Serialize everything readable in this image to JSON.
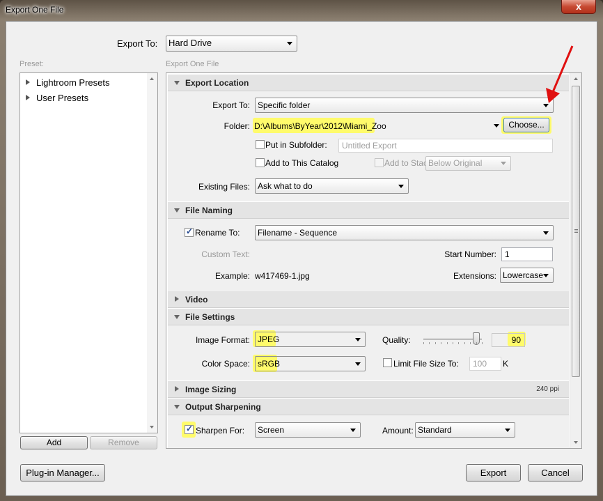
{
  "window": {
    "title": "Export One File",
    "close_glyph": "x"
  },
  "export_to": {
    "label": "Export To:",
    "value": "Hard Drive"
  },
  "preset": {
    "label": "Preset:",
    "items": [
      {
        "label": "Lightroom Presets"
      },
      {
        "label": "User Presets"
      }
    ],
    "add_label": "Add",
    "remove_label": "Remove"
  },
  "panel_title": "Export One File",
  "sections": {
    "export_location": {
      "title": "Export Location",
      "export_to_label": "Export To:",
      "export_to_value": "Specific folder",
      "folder_label": "Folder:",
      "folder_value": "D:\\Albums\\ByYear\\2012\\Miami_Zoo",
      "choose_label": "Choose...",
      "subfolder_label": "Put in Subfolder:",
      "subfolder_value": "Untitled Export",
      "add_catalog_label": "Add to This Catalog",
      "add_stack_label": "Add to Stack:",
      "stack_value": "Below Original",
      "existing_label": "Existing Files:",
      "existing_value": "Ask what to do"
    },
    "file_naming": {
      "title": "File Naming",
      "rename_label": "Rename To:",
      "rename_value": "Filename - Sequence",
      "custom_text_label": "Custom Text:",
      "start_number_label": "Start Number:",
      "start_number_value": "1",
      "example_label": "Example:",
      "example_value": "w417469-1.jpg",
      "extensions_label": "Extensions:",
      "extensions_value": "Lowercase"
    },
    "video": {
      "title": "Video"
    },
    "file_settings": {
      "title": "File Settings",
      "format_label": "Image Format:",
      "format_value": "JPEG",
      "quality_label": "Quality:",
      "quality_value": "90",
      "quality_level": 90,
      "colorspace_label": "Color Space:",
      "colorspace_value": "sRGB",
      "limit_label": "Limit File Size To:",
      "limit_value": "100",
      "limit_unit": "K"
    },
    "image_sizing": {
      "title": "Image Sizing",
      "summary": "240 ppi"
    },
    "output_sharpening": {
      "title": "Output Sharpening",
      "sharpen_label": "Sharpen For:",
      "sharpen_value": "Screen",
      "amount_label": "Amount:",
      "amount_value": "Standard"
    }
  },
  "footer": {
    "plugin_label": "Plug-in Manager...",
    "export_label": "Export",
    "cancel_label": "Cancel"
  },
  "colors": {
    "highlight": "#ffff7a",
    "annotation_arrow": "#e01010",
    "close_button": "#c74a33"
  }
}
